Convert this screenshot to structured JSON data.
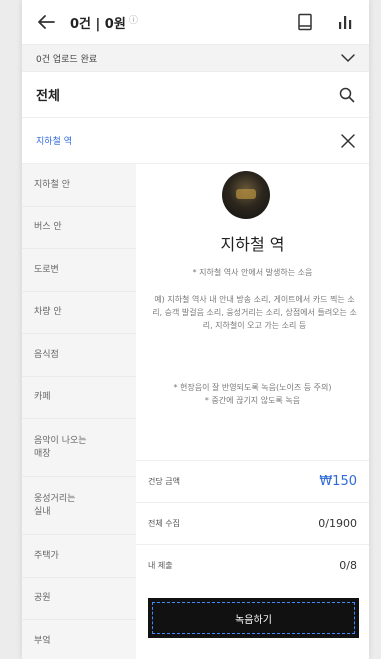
{
  "topbar": {
    "counts": "0건 | 0원",
    "info_glyph": "ⓘ"
  },
  "upload": {
    "status": "0건 업로드 완료"
  },
  "category": {
    "title": "전체"
  },
  "selected": {
    "title": "지하철 역"
  },
  "sidebar": {
    "items": [
      {
        "label": "지하철 안"
      },
      {
        "label": "버스 안"
      },
      {
        "label": "도로변"
      },
      {
        "label": "차량 안"
      },
      {
        "label": "음식점"
      },
      {
        "label": "카페"
      },
      {
        "label": "음악이 나오는\n매장"
      },
      {
        "label": "웅성거리는\n실내"
      },
      {
        "label": "주택가"
      },
      {
        "label": "공원"
      },
      {
        "label": "부엌"
      }
    ]
  },
  "detail": {
    "title": "지하철 역",
    "subtitle": "* 지하철 역사 안에서 발생하는 소음",
    "example": "예) 지하철 역사 내 안내 방송 소리, 게이트에서 카드 찍는 소리, 승객 발걸음 소리, 웅성거리는 소리, 상점에서 들려오는 소리, 지하철이 오고 가는 소리 등",
    "notes": "* 현장음이 잘 반영되도록 녹음(노이즈 등 주의)\n* 중간에 끊기지 않도록 녹음",
    "price_label": "건당 금액",
    "price_value": "₩150",
    "total_label": "전체 수집",
    "total_value": "0/1900",
    "mine_label": "내 제출",
    "mine_value": "0/8",
    "record_label": "녹음하기"
  },
  "icons": {
    "back": "arrow-left-icon",
    "book": "bookmark-icon",
    "chart": "bar-chart-icon",
    "expand": "chevron-down-icon",
    "search": "search-icon",
    "close": "close-icon"
  }
}
